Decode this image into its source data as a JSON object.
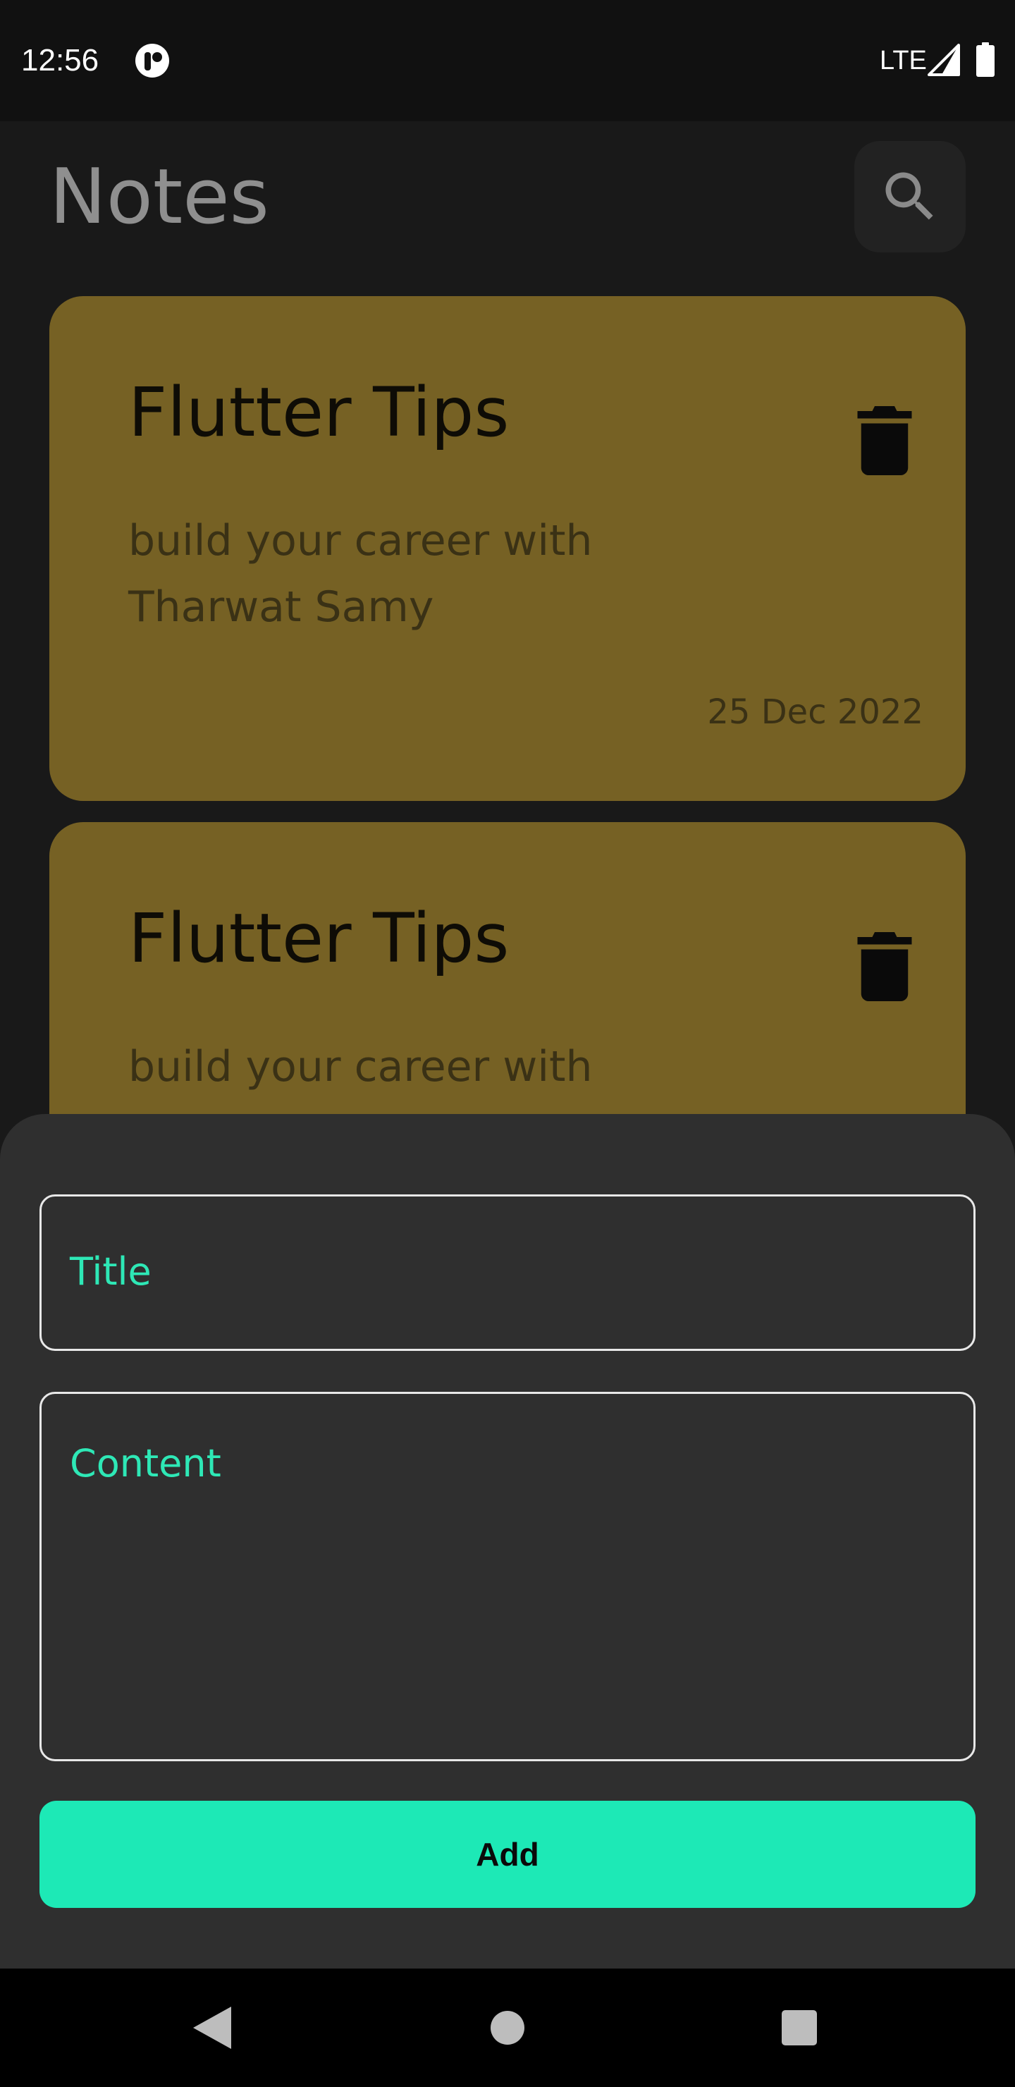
{
  "status_bar": {
    "time": "12:56",
    "network": "LTE",
    "icons": [
      "app-notification-icon",
      "signal-icon",
      "battery-icon"
    ]
  },
  "header": {
    "title": "Notes",
    "search_icon": "search-icon"
  },
  "notes": [
    {
      "title": "Flutter Tips",
      "content": "build your career with Tharwat Samy",
      "date": "25 Dec 2022",
      "delete_icon": "trash-icon"
    },
    {
      "title": "Flutter Tips",
      "content": "build your career with",
      "delete_icon": "trash-icon"
    }
  ],
  "add_note_sheet": {
    "title_placeholder": "Title",
    "content_placeholder": "Content",
    "add_label": "Add"
  },
  "nav_bar": {
    "icons": [
      "back-icon",
      "home-icon",
      "recents-icon"
    ]
  },
  "colors": {
    "background": "#191919",
    "card": "#766124",
    "sheet": "#2f2f2f",
    "accent": "#1de9b6"
  }
}
